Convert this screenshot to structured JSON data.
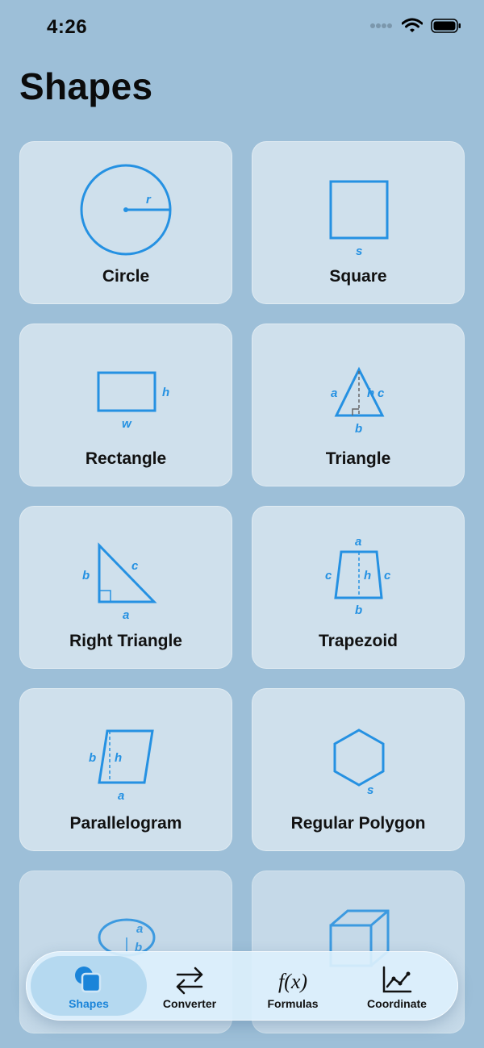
{
  "status": {
    "time": "4:26"
  },
  "page": {
    "title": "Shapes"
  },
  "shapes": [
    {
      "label": "Circle",
      "var1": "r"
    },
    {
      "label": "Square",
      "var1": "s"
    },
    {
      "label": "Rectangle",
      "var1": "h",
      "var2": "w"
    },
    {
      "label": "Triangle",
      "var1": "a",
      "var2": "h",
      "var3": "c",
      "var4": "b"
    },
    {
      "label": "Right Triangle",
      "var1": "b",
      "var2": "c",
      "var3": "a"
    },
    {
      "label": "Trapezoid",
      "var1": "a",
      "var2": "c",
      "var3": "h",
      "var4": "c",
      "var5": "b"
    },
    {
      "label": "Parallelogram",
      "var1": "b",
      "var2": "h",
      "var3": "a"
    },
    {
      "label": "Regular Polygon",
      "var1": "s"
    },
    {
      "label": "",
      "var1": "a",
      "var2": "b"
    },
    {
      "label": ""
    }
  ],
  "tabs": [
    {
      "label": "Shapes",
      "icon": "shapes-icon",
      "active": true
    },
    {
      "label": "Converter",
      "icon": "converter-arrows-icon",
      "active": false
    },
    {
      "label": "Formulas",
      "icon": "function-fx-icon",
      "active": false,
      "glyph": "f(x)"
    },
    {
      "label": "Coordinate",
      "icon": "chart-line-icon",
      "active": false
    }
  ],
  "colors": {
    "accent": "#2591e2",
    "background": "#9dbfd8",
    "card": "#cfe0ec"
  }
}
